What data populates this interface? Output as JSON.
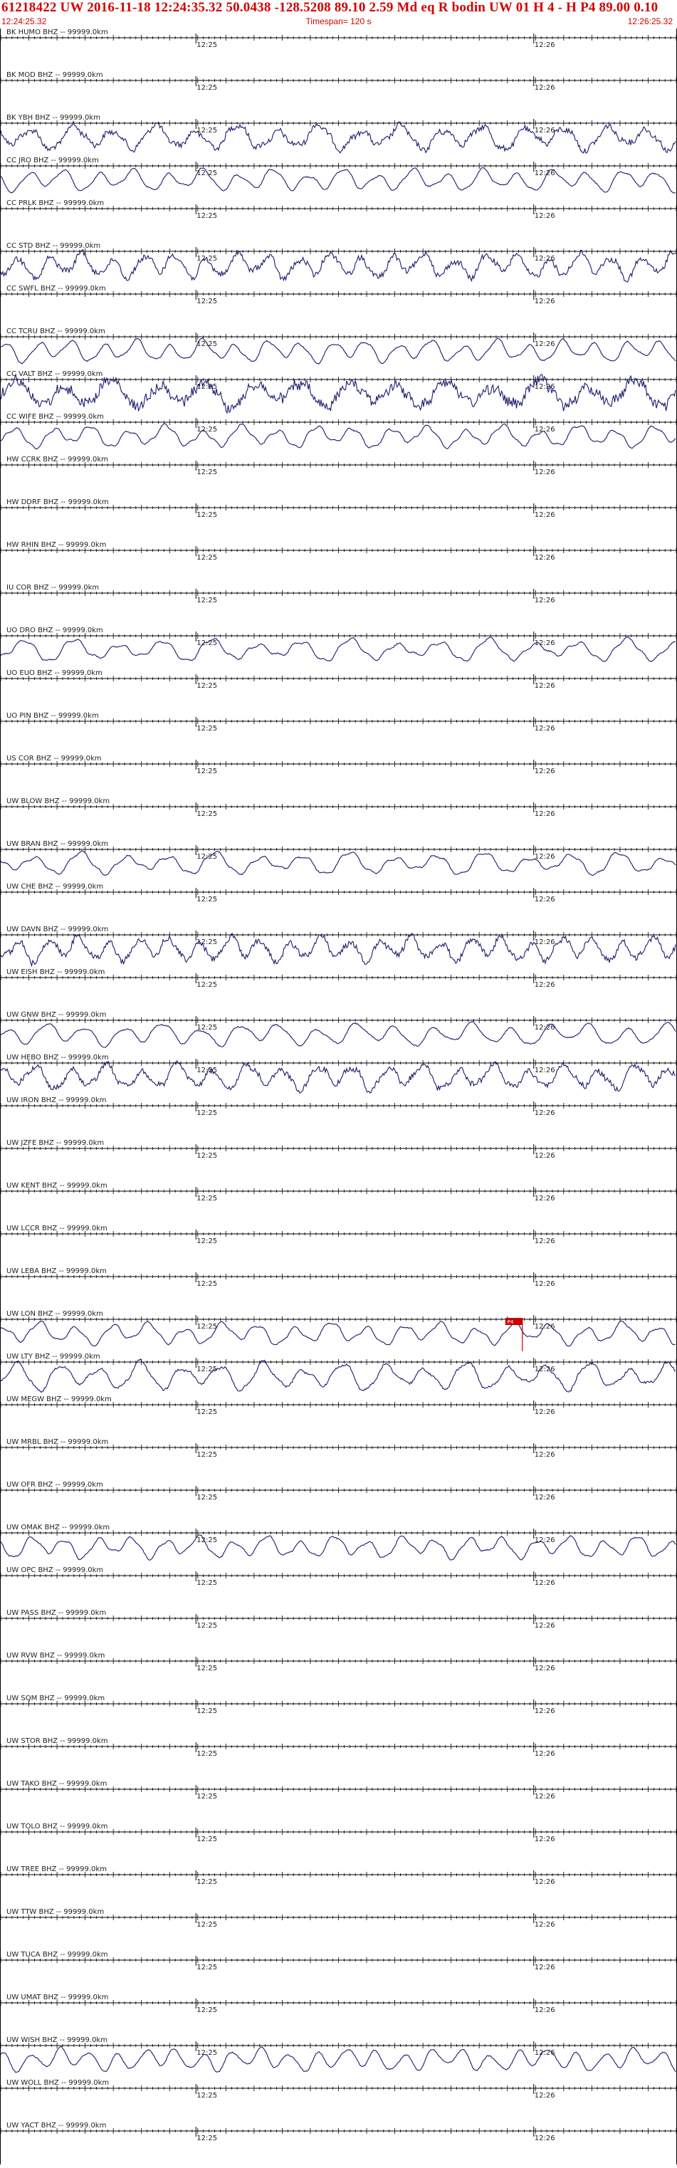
{
  "header": {
    "title_line": "61218422 UW 2016-11-18 12:24:35.32    50.0438  -128.5208  89.10  2.59 Md  eq  R bodin    UW 01  H   4  -  H P4   89.00  0.10",
    "start_time": "12:24:25.32",
    "timespan_label": "Timespan= 120 s",
    "end_time": "12:26:25.32"
  },
  "colors": {
    "title": "#d40000",
    "trace": "#1a1a6e",
    "axis": "#000000",
    "pick_marker": "#cc0000"
  },
  "chart_data": {
    "type": "line",
    "title": "61218422 UW 2016-11-18 12:24:35.32",
    "x_tick_labels": [
      "12:25",
      "12:26"
    ],
    "x_tick_times": [
      "12:25:00",
      "12:26:00"
    ],
    "timespan_s": 120,
    "pick": {
      "channel": "UW LON BHZ",
      "label": "P4"
    },
    "channels": [
      {
        "label": "BK HUMO BHZ -- 99999.0km",
        "signal": 0
      },
      {
        "label": "BK MOD BHZ -- 99999.0km",
        "signal": 0
      },
      {
        "label": "BK YBH BHZ -- 99999.0km",
        "signal": 3
      },
      {
        "label": "CC JRO BHZ -- 99999.0km",
        "signal": 2
      },
      {
        "label": "CC PRLK BHZ -- 99999.0km",
        "signal": 0
      },
      {
        "label": "CC STD BHZ -- 99999.0km",
        "signal": 3
      },
      {
        "label": "CC SWFL BHZ -- 99999.0km",
        "signal": 0
      },
      {
        "label": "CC TCRU BHZ -- 99999.0km",
        "signal": 2
      },
      {
        "label": "CC VALT BHZ -- 99999.0km",
        "signal": 4
      },
      {
        "label": "CC WIFE BHZ -- 99999.0km",
        "signal": 2
      },
      {
        "label": "HW CCRK BHZ -- 99999.0km",
        "signal": 0
      },
      {
        "label": "HW DDRF BHZ -- 99999.0km",
        "signal": 0
      },
      {
        "label": "HW RHIN BHZ -- 99999.0km",
        "signal": 0
      },
      {
        "label": "IU COR BHZ -- 99999.0km",
        "signal": 0
      },
      {
        "label": "UO DRO BHZ -- 99999.0km",
        "signal": 1
      },
      {
        "label": "UO EUO BHZ -- 99999.0km",
        "signal": 0
      },
      {
        "label": "UO PIN BHZ -- 99999.0km",
        "signal": 0
      },
      {
        "label": "US COR BHZ -- 99999.0km",
        "signal": 0
      },
      {
        "label": "UW BLOW BHZ -- 99999.0km",
        "signal": 0
      },
      {
        "label": "UW BRAN BHZ -- 99999.0km",
        "signal": 1
      },
      {
        "label": "UW CHE BHZ -- 99999.0km",
        "signal": 0
      },
      {
        "label": "UW DAVN BHZ -- 99999.0km",
        "signal": 3
      },
      {
        "label": "UW EISH BHZ -- 99999.0km",
        "signal": 0
      },
      {
        "label": "UW GNW BHZ -- 99999.0km",
        "signal": 1
      },
      {
        "label": "UW HEBO BHZ -- 99999.0km",
        "signal": 3
      },
      {
        "label": "UW IRON BHZ -- 99999.0km",
        "signal": 0
      },
      {
        "label": "UW JZFE BHZ -- 99999.0km",
        "signal": 0
      },
      {
        "label": "UW KENT BHZ -- 99999.0km",
        "signal": 0
      },
      {
        "label": "UW LCCR BHZ -- 99999.0km",
        "signal": 0
      },
      {
        "label": "UW LEBA BHZ -- 99999.0km",
        "signal": 0
      },
      {
        "label": "UW LON BHZ -- 99999.0km",
        "signal": 1
      },
      {
        "label": "UW LTY BHZ -- 99999.0km",
        "signal": 5
      },
      {
        "label": "UW MEGW BHZ -- 99999.0km",
        "signal": 0
      },
      {
        "label": "UW MRBL BHZ -- 99999.0km",
        "signal": 0
      },
      {
        "label": "UW OFR BHZ -- 99999.0km",
        "signal": 0
      },
      {
        "label": "UW OMAK BHZ -- 99999.0km",
        "signal": 1
      },
      {
        "label": "UW OPC BHZ -- 99999.0km",
        "signal": 0
      },
      {
        "label": "UW PASS BHZ -- 99999.0km",
        "signal": 0
      },
      {
        "label": "UW RVW BHZ -- 99999.0km",
        "signal": 0
      },
      {
        "label": "UW SQM BHZ -- 99999.0km",
        "signal": 0
      },
      {
        "label": "UW STOR BHZ -- 99999.0km",
        "signal": 0
      },
      {
        "label": "UW TAKO BHZ -- 99999.0km",
        "signal": 0
      },
      {
        "label": "UW TOLO BHZ -- 99999.0km",
        "signal": 0
      },
      {
        "label": "UW TREE BHZ -- 99999.0km",
        "signal": 0
      },
      {
        "label": "UW TTW BHZ -- 99999.0km",
        "signal": 0
      },
      {
        "label": "UW TUCA BHZ -- 99999.0km",
        "signal": 0
      },
      {
        "label": "UW UMAT BHZ -- 99999.0km",
        "signal": 0
      },
      {
        "label": "UW WISH BHZ -- 99999.0km",
        "signal": 2
      },
      {
        "label": "UW WOLL BHZ -- 99999.0km",
        "signal": 0
      },
      {
        "label": "UW YACT BHZ -- 99999.0km",
        "signal": 0
      }
    ]
  }
}
